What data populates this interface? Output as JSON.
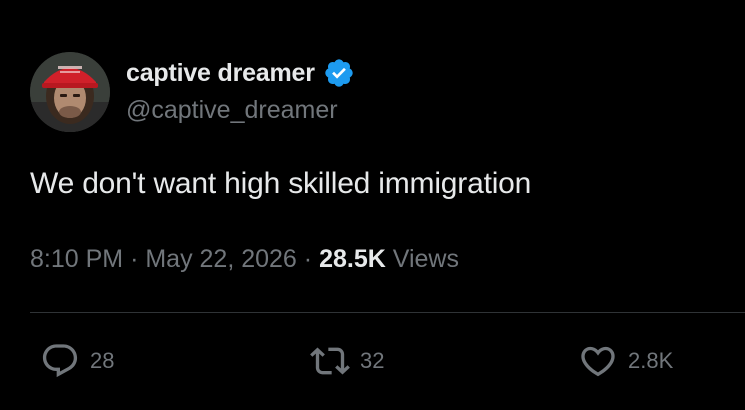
{
  "user": {
    "display_name": "captive dreamer",
    "handle": "@captive_dreamer",
    "verified": true
  },
  "tweet": {
    "text": "We don't want high skilled immigration",
    "time": "8:10 PM",
    "date": "May 22, 2026",
    "separator": "·",
    "views_count": "28.5K",
    "views_label": "Views"
  },
  "actions": {
    "replies": "28",
    "retweets": "32",
    "likes": "2.8K"
  },
  "icons": {
    "reply": "reply-icon",
    "retweet": "retweet-icon",
    "like": "heart-icon",
    "verified": "verified-badge-icon"
  },
  "colors": {
    "background": "#000000",
    "primary_text": "#e7e9ea",
    "secondary_text": "#71767b",
    "verified_blue": "#1d9bf0",
    "divider": "#2f3336"
  }
}
